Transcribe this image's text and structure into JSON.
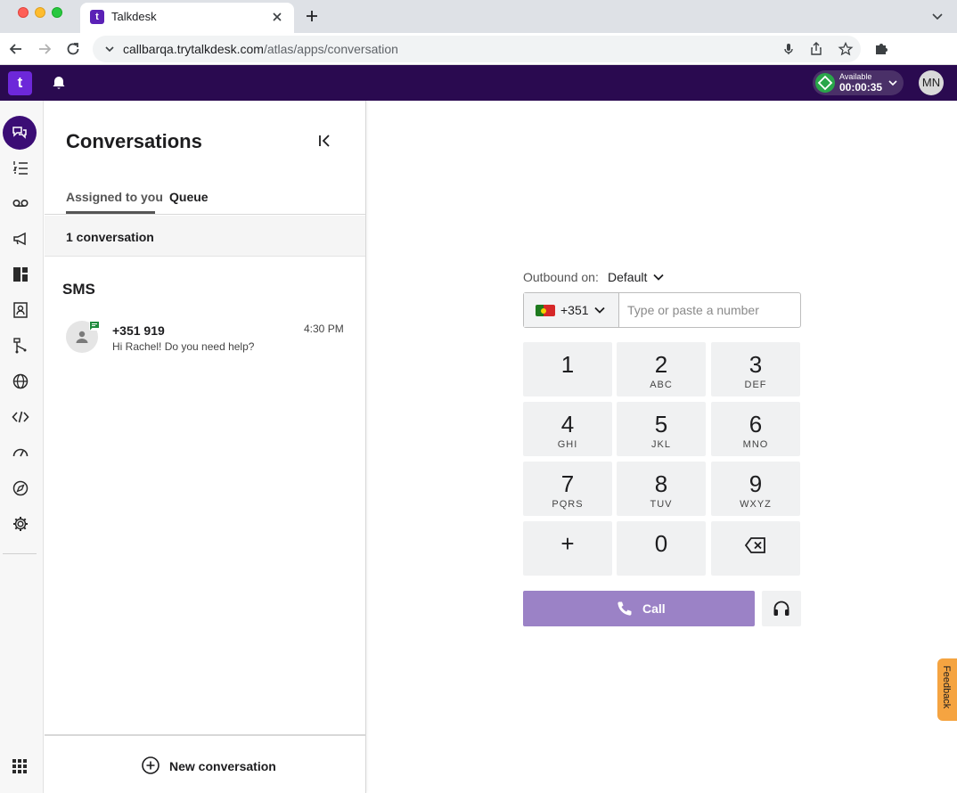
{
  "browser": {
    "tab_title": "Talkdesk",
    "tab_favicon_text": "t",
    "url_host": "callbarqa.trytalkdesk.com",
    "url_path": "/atlas/apps/conversation"
  },
  "appbar": {
    "logo_text": "t",
    "status": {
      "label": "Available",
      "timer": "00:00:35",
      "color": "#2aa64a"
    },
    "user_initials": "MN",
    "color": "#2a0a50"
  },
  "leftnav": {
    "items": [
      {
        "name": "conversations",
        "icon": "conversation-icon",
        "active": true
      },
      {
        "name": "list",
        "icon": "list-numbered-icon"
      },
      {
        "name": "voicemail",
        "icon": "voicemail-icon"
      },
      {
        "name": "campaigns",
        "icon": "megaphone-icon"
      },
      {
        "name": "dashboard",
        "icon": "dashboard-icon"
      },
      {
        "name": "contacts",
        "icon": "contact-card-icon"
      },
      {
        "name": "flows",
        "icon": "flow-icon"
      },
      {
        "name": "globe",
        "icon": "globe-icon"
      },
      {
        "name": "developer",
        "icon": "code-icon"
      },
      {
        "name": "performance",
        "icon": "gauge-icon"
      },
      {
        "name": "explore",
        "icon": "compass-icon"
      },
      {
        "name": "settings",
        "icon": "gear-icon"
      }
    ],
    "apps_icon": "apps-grid-icon"
  },
  "conversations": {
    "title": "Conversations",
    "tabs": [
      {
        "label": "Assigned to you",
        "active": true
      },
      {
        "label": "Queue",
        "active": false
      }
    ],
    "count_text": "1 conversation",
    "section_label": "SMS",
    "items": [
      {
        "name": "+351 919",
        "preview": "Hi Rachel! Do you need help?",
        "time": "4:30 PM",
        "channel_color": "#1f8a3d"
      }
    ],
    "new_conversation_label": "New conversation"
  },
  "dialer": {
    "outbound_label": "Outbound on:",
    "outbound_value": "Default",
    "country_code": "+351",
    "number_placeholder": "Type or paste a number",
    "keys": [
      {
        "digit": "1",
        "letters": ""
      },
      {
        "digit": "2",
        "letters": "ABC"
      },
      {
        "digit": "3",
        "letters": "DEF"
      },
      {
        "digit": "4",
        "letters": "GHI"
      },
      {
        "digit": "5",
        "letters": "JKL"
      },
      {
        "digit": "6",
        "letters": "MNO"
      },
      {
        "digit": "7",
        "letters": "PQRS"
      },
      {
        "digit": "8",
        "letters": "TUV"
      },
      {
        "digit": "9",
        "letters": "WXYZ"
      },
      {
        "digit": "+",
        "letters": ""
      },
      {
        "digit": "0",
        "letters": ""
      },
      {
        "digit": "",
        "letters": "",
        "icon": "backspace-icon"
      }
    ],
    "call_label": "Call",
    "call_color": "#9b82c6"
  },
  "feedback_label": "Feedback"
}
